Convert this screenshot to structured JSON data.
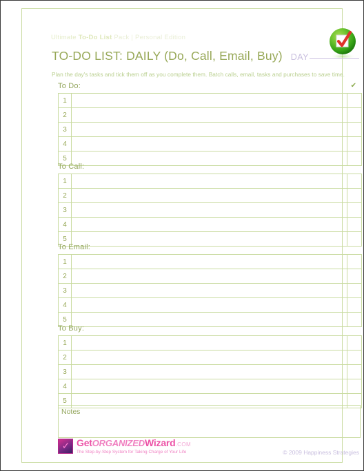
{
  "document": {
    "brand_header": {
      "prefix": "Ultimate ",
      "strong": "To-Do List",
      "suffix": " Pack",
      "separator": " | ",
      "edition": "Personal Edition"
    },
    "logo_icon": "green-sphere-checkbox-icon",
    "title": "TO-DO LIST: DAILY (Do, Call, Email, Buy)",
    "day_label": "DAY",
    "day_value": "",
    "subtitle": "Plan the day's tasks and tick them off as you complete them. Batch calls, email, tasks and purchases to save time.",
    "check_column_symbol": "✔"
  },
  "sections": [
    {
      "label": "To Do:",
      "show_check_header": true,
      "rows": [
        {
          "number": "1",
          "text": "",
          "checked": ""
        },
        {
          "number": "2",
          "text": "",
          "checked": ""
        },
        {
          "number": "3",
          "text": "",
          "checked": ""
        },
        {
          "number": "4",
          "text": "",
          "checked": ""
        },
        {
          "number": "5",
          "text": "",
          "checked": ""
        }
      ]
    },
    {
      "label": "To Call:",
      "show_check_header": false,
      "rows": [
        {
          "number": "1",
          "text": "",
          "checked": ""
        },
        {
          "number": "2",
          "text": "",
          "checked": ""
        },
        {
          "number": "3",
          "text": "",
          "checked": ""
        },
        {
          "number": "4",
          "text": "",
          "checked": ""
        },
        {
          "number": "5",
          "text": "",
          "checked": ""
        }
      ]
    },
    {
      "label": "To Email:",
      "show_check_header": false,
      "rows": [
        {
          "number": "1",
          "text": "",
          "checked": ""
        },
        {
          "number": "2",
          "text": "",
          "checked": ""
        },
        {
          "number": "3",
          "text": "",
          "checked": ""
        },
        {
          "number": "4",
          "text": "",
          "checked": ""
        },
        {
          "number": "5",
          "text": "",
          "checked": ""
        }
      ]
    },
    {
      "label": "To Buy:",
      "show_check_header": false,
      "rows": [
        {
          "number": "1",
          "text": "",
          "checked": ""
        },
        {
          "number": "2",
          "text": "",
          "checked": ""
        },
        {
          "number": "3",
          "text": "",
          "checked": ""
        },
        {
          "number": "4",
          "text": "",
          "checked": ""
        },
        {
          "number": "5",
          "text": "",
          "checked": ""
        }
      ]
    }
  ],
  "notes": {
    "label": "Notes",
    "value": ""
  },
  "footer": {
    "logo": {
      "mark_icon": "purple-check-square-icon",
      "word_get": "Get",
      "word_organized": "ORGANIZED",
      "word_wizard": "Wizard",
      "word_com": ".COM",
      "tagline": "The Step-by-Step System for Taking Charge of Your Life"
    },
    "copyright": "© 2009 Happiness Strategies"
  },
  "colors": {
    "border_green": "#c9dba0",
    "title_olive": "#97a857",
    "label_olive": "#92a55b",
    "subtitle_green": "#b9cf8e",
    "lavender": "#c9bfdf",
    "brand_pink": "#ec52a6",
    "logo_green": "#58b930",
    "logo_check_red": "#e0322a"
  }
}
